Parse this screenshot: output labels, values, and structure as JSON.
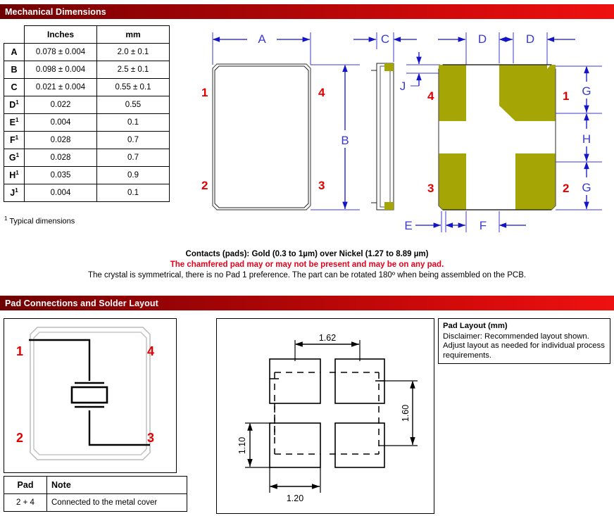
{
  "sections": {
    "mechanical": "Mechanical Dimensions",
    "padconn": "Pad Connections and Solder Layout"
  },
  "dim_table": {
    "headers": [
      "",
      "Inches",
      "mm"
    ],
    "rows": [
      {
        "label": "A",
        "sup": "",
        "inches": "0.078 ± 0.004",
        "mm": "2.0 ± 0.1"
      },
      {
        "label": "B",
        "sup": "",
        "inches": "0.098 ± 0.004",
        "mm": "2.5 ± 0.1"
      },
      {
        "label": "C",
        "sup": "",
        "inches": "0.021 ± 0.004",
        "mm": "0.55 ± 0.1"
      },
      {
        "label": "D",
        "sup": "1",
        "inches": "0.022",
        "mm": "0.55"
      },
      {
        "label": "E",
        "sup": "1",
        "inches": "0.004",
        "mm": "0.1"
      },
      {
        "label": "F",
        "sup": "1",
        "inches": "0.028",
        "mm": "0.7"
      },
      {
        "label": "G",
        "sup": "1",
        "inches": "0.028",
        "mm": "0.7"
      },
      {
        "label": "H",
        "sup": "1",
        "inches": "0.035",
        "mm": "0.9"
      },
      {
        "label": "J",
        "sup": "1",
        "inches": "0.004",
        "mm": "0.1"
      }
    ],
    "footnote_marker": "1",
    "footnote": "Typical dimensions"
  },
  "drawings": {
    "top_view": {
      "dim_a": "A",
      "dim_b": "B",
      "pads": [
        "1",
        "4",
        "2",
        "3"
      ]
    },
    "side_view": {
      "dim_c": "C"
    },
    "bottom_view": {
      "dim_d1": "D",
      "dim_d2": "D",
      "dim_g1": "G",
      "dim_h": "H",
      "dim_g2": "G",
      "dim_e": "E",
      "dim_f": "F",
      "dim_j": "J",
      "pads": [
        "4",
        "1",
        "3",
        "2"
      ],
      "pad_color": "#a5a505"
    }
  },
  "notes": {
    "line1": "Contacts (pads): Gold (0.3 to 1µm) over Nickel (1.27 to 8.89 µm)",
    "line2": "The chamfered pad may or may not be present and may be on any pad.",
    "line3": "The crystal is symmetrical, there is no Pad 1 preference. The part can be rotated 180º when being assembled on the PCB.",
    "warning_color": "#e8001a"
  },
  "pad_connection": {
    "pads": [
      "1",
      "4",
      "2",
      "3"
    ]
  },
  "pad_note_table": {
    "headers": [
      "Pad",
      "Note"
    ],
    "rows": [
      {
        "pad": "2 + 4",
        "note": "Connected to the metal cover"
      }
    ]
  },
  "solder_layout": {
    "dim_top": "1.62",
    "dim_right": "1.60",
    "dim_left": "1.10",
    "dim_bottom": "1.20"
  },
  "layout_note": {
    "title": "Pad Layout  (mm)",
    "body": "Disclaimer: Recommended layout shown. Adjust layout as needed for individual process requirements."
  }
}
